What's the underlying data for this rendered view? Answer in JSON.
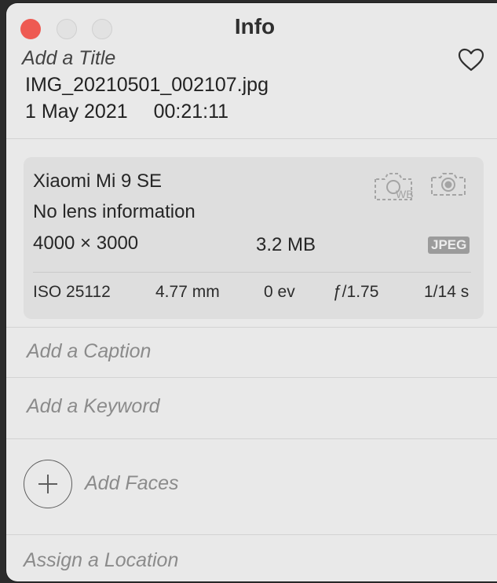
{
  "window": {
    "title": "Info"
  },
  "header": {
    "add_title_placeholder": "Add a Title",
    "filename": "IMG_20210501_002107.jpg",
    "date": "1 May 2021",
    "time": "00:21:11"
  },
  "camera": {
    "device": "Xiaomi Mi 9 SE",
    "lens": "No lens information",
    "dimensions": "4000 × 3000",
    "file_size": "3.2 MB",
    "format": "JPEG",
    "icons": [
      "white-balance-icon",
      "live-photo-icon"
    ],
    "exif": {
      "iso": "ISO 25112",
      "focal_length": "4.77 mm",
      "exposure_bias": "0 ev",
      "aperture": "ƒ/1.75",
      "shutter": "1/14 s"
    }
  },
  "fields": {
    "caption": "Add a Caption",
    "keyword": "Add a Keyword",
    "faces": "Add Faces",
    "location": "Assign a Location"
  },
  "colors": {
    "close": "#ee5a52",
    "panel": "#e9e9e9",
    "card": "#dedede",
    "placeholder": "#8b8b8b"
  }
}
